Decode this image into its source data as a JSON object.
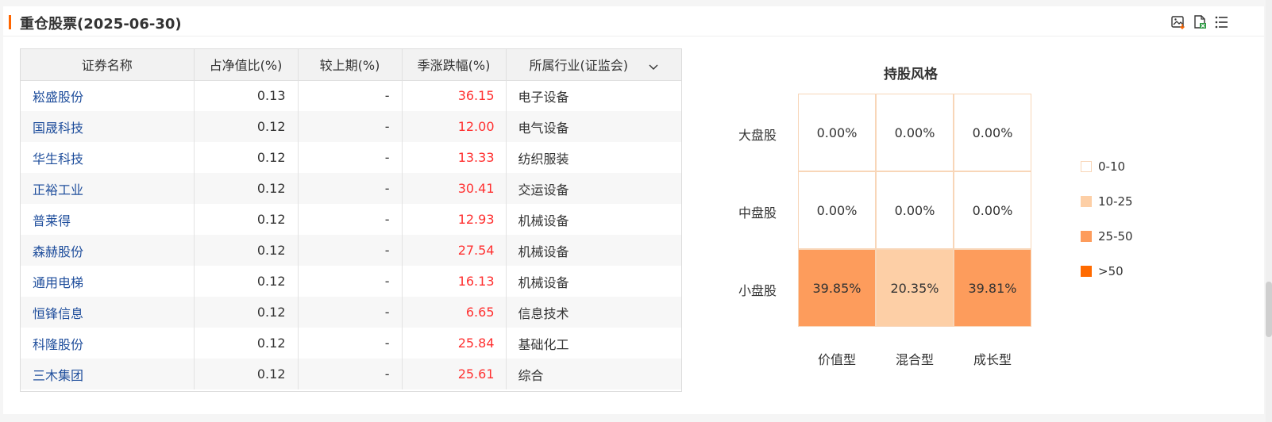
{
  "header": {
    "title": "重仓股票(2025-06-30)",
    "icons": [
      "export-image-icon",
      "export-excel-icon",
      "list-menu-icon"
    ]
  },
  "table": {
    "columns": [
      "证券名称",
      "占净值比(%)",
      "较上期(%)",
      "季涨跌幅(%)",
      "所属行业(证监会)"
    ],
    "rows": [
      {
        "name": "崧盛股份",
        "ratio": "0.13",
        "change": "-",
        "quarter": "36.15",
        "industry": "电子设备"
      },
      {
        "name": "国晟科技",
        "ratio": "0.12",
        "change": "-",
        "quarter": "12.00",
        "industry": "电气设备"
      },
      {
        "name": "华生科技",
        "ratio": "0.12",
        "change": "-",
        "quarter": "13.33",
        "industry": "纺织服装"
      },
      {
        "name": "正裕工业",
        "ratio": "0.12",
        "change": "-",
        "quarter": "30.41",
        "industry": "交运设备"
      },
      {
        "name": "普莱得",
        "ratio": "0.12",
        "change": "-",
        "quarter": "12.93",
        "industry": "机械设备"
      },
      {
        "name": "森赫股份",
        "ratio": "0.12",
        "change": "-",
        "quarter": "27.54",
        "industry": "机械设备"
      },
      {
        "name": "通用电梯",
        "ratio": "0.12",
        "change": "-",
        "quarter": "16.13",
        "industry": "机械设备"
      },
      {
        "name": "恒锋信息",
        "ratio": "0.12",
        "change": "-",
        "quarter": "6.65",
        "industry": "信息技术"
      },
      {
        "name": "科隆股份",
        "ratio": "0.12",
        "change": "-",
        "quarter": "25.84",
        "industry": "基础化工"
      },
      {
        "name": "三木集团",
        "ratio": "0.12",
        "change": "-",
        "quarter": "25.61",
        "industry": "综合"
      }
    ]
  },
  "style_box": {
    "title": "持股风格",
    "row_labels": [
      "大盘股",
      "中盘股",
      "小盘股"
    ],
    "col_labels": [
      "价值型",
      "混合型",
      "成长型"
    ],
    "cells": [
      [
        "0.00%",
        "0.00%",
        "0.00%"
      ],
      [
        "0.00%",
        "0.00%",
        "0.00%"
      ],
      [
        "39.85%",
        "20.35%",
        "39.81%"
      ]
    ],
    "cell_colors": [
      [
        "#ffffff",
        "#ffffff",
        "#ffffff"
      ],
      [
        "#ffffff",
        "#ffffff",
        "#ffffff"
      ],
      [
        "#fd9c5c",
        "#fdcfa6",
        "#fd9c5c"
      ]
    ],
    "legend": [
      {
        "label": "0-10",
        "color": "#ffffff"
      },
      {
        "label": "10-25",
        "color": "#fdcfa6"
      },
      {
        "label": "25-50",
        "color": "#fd9c5c"
      },
      {
        "label": ">50",
        "color": "#ff6a00"
      }
    ]
  },
  "colors": {
    "accent": "#ff6600",
    "link": "#1f4e9c",
    "positive": "#ff3030"
  }
}
